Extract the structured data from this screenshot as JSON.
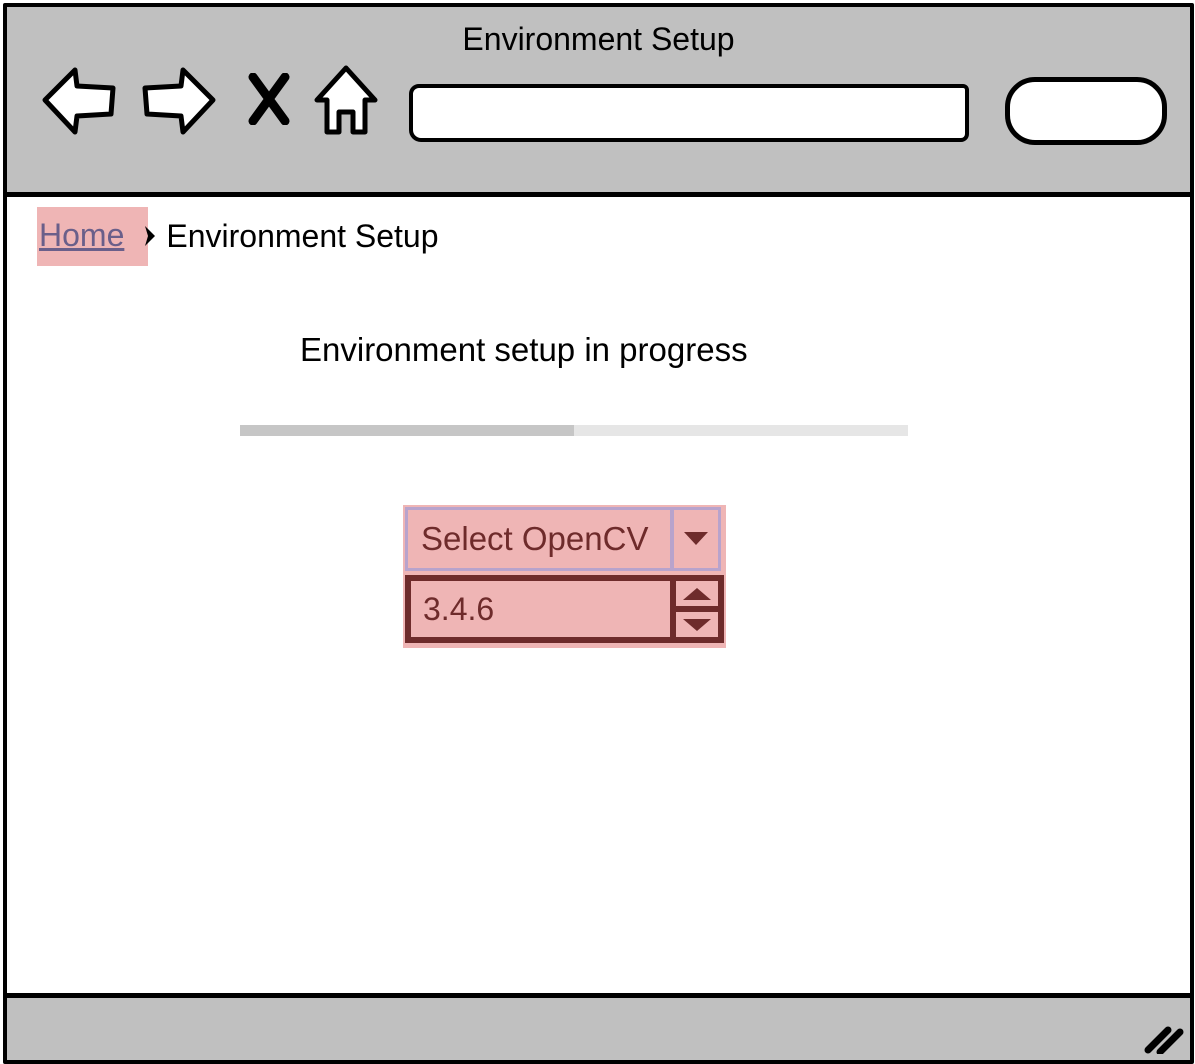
{
  "window": {
    "title": "Environment Setup"
  },
  "toolbar": {
    "icons": [
      "back-arrow-icon",
      "forward-arrow-icon",
      "close-icon",
      "home-icon",
      "search-icon"
    ],
    "address_value": "",
    "search_value": ""
  },
  "breadcrumb": {
    "home_label": "Home",
    "current_label": "Environment Setup"
  },
  "main": {
    "status_text": "Environment setup in progress",
    "progress_fraction": 0.5
  },
  "opencv": {
    "select_label": "Select OpenCV",
    "version_value": "3.4.6"
  },
  "colors": {
    "chrome": "#c0c0c0",
    "highlight": "#efb5b5",
    "stepper_border": "#6e2b2b",
    "select_border": "#b8a3cc",
    "link": "#6a5f8a"
  }
}
